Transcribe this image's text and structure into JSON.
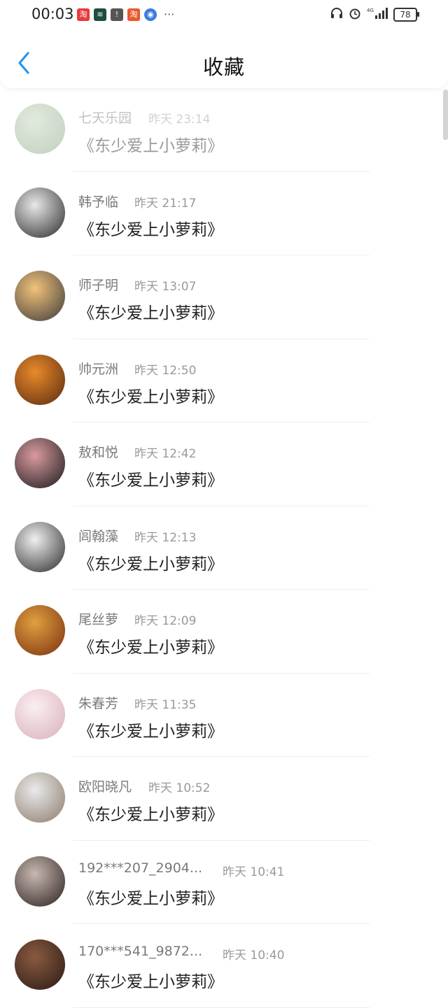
{
  "status_bar": {
    "time": "00:03",
    "left_icons": [
      {
        "icon": "taobao-icon",
        "glyph": "淘",
        "color": "#e83a3a"
      },
      {
        "icon": "app-icon",
        "glyph": "≋",
        "color": "#1f4d3a"
      },
      {
        "icon": "alert-icon",
        "glyph": "!",
        "color": "#555555"
      },
      {
        "icon": "taobao-icon",
        "glyph": "淘",
        "color": "#e85a2a"
      },
      {
        "icon": "browser-icon",
        "glyph": "◉",
        "color": "#3a7be0"
      }
    ],
    "more": "···",
    "battery": "78"
  },
  "nav": {
    "title": "收藏",
    "back_color": "#2196f3"
  },
  "items": [
    {
      "name": "七天乐园",
      "time": "昨天 23:14",
      "title": "《东少爱上小萝莉》",
      "avatar_colors": [
        "#c9d8c2",
        "#8fa889"
      ],
      "faded": true
    },
    {
      "name": "韩予临",
      "time": "昨天 21:17",
      "title": "《东少爱上小萝莉》",
      "avatar_colors": [
        "#e8e8e8",
        "#2a2a2a"
      ]
    },
    {
      "name": "师子明",
      "time": "昨天 13:07",
      "title": "《东少爱上小萝莉》",
      "avatar_colors": [
        "#f2c27a",
        "#3a3a3a"
      ]
    },
    {
      "name": "帅元洲",
      "time": "昨天 12:50",
      "title": "《东少爱上小萝莉》",
      "avatar_colors": [
        "#e88a2a",
        "#5a2a10"
      ]
    },
    {
      "name": "敖和悦",
      "time": "昨天 12:42",
      "title": "《东少爱上小萝莉》",
      "avatar_colors": [
        "#d99aa0",
        "#1a1a1a"
      ]
    },
    {
      "name": "闾翰藻",
      "time": "昨天 12:13",
      "title": "《东少爱上小萝莉》",
      "avatar_colors": [
        "#f0f0f0",
        "#2a2a2a"
      ]
    },
    {
      "name": "尾丝萝",
      "time": "昨天 12:09",
      "title": "《东少爱上小萝莉》",
      "avatar_colors": [
        "#e0a040",
        "#7a3010"
      ]
    },
    {
      "name": "朱春芳",
      "time": "昨天 11:35",
      "title": "《东少爱上小萝莉》",
      "avatar_colors": [
        "#fbeef2",
        "#d8b0b8"
      ]
    },
    {
      "name": "欧阳晓凡",
      "time": "昨天 10:52",
      "title": "《东少爱上小萝莉》",
      "avatar_colors": [
        "#eaeaea",
        "#8a7a6a"
      ]
    },
    {
      "name": "192***207_2904...",
      "time": "昨天 10:41",
      "title": "《东少爱上小萝莉》",
      "avatar_colors": [
        "#c8b8b0",
        "#2a2020"
      ]
    },
    {
      "name": "170***541_9872...",
      "time": "昨天 10:40",
      "title": "《东少爱上小萝莉》",
      "avatar_colors": [
        "#8a5a40",
        "#2a1a14"
      ]
    }
  ]
}
